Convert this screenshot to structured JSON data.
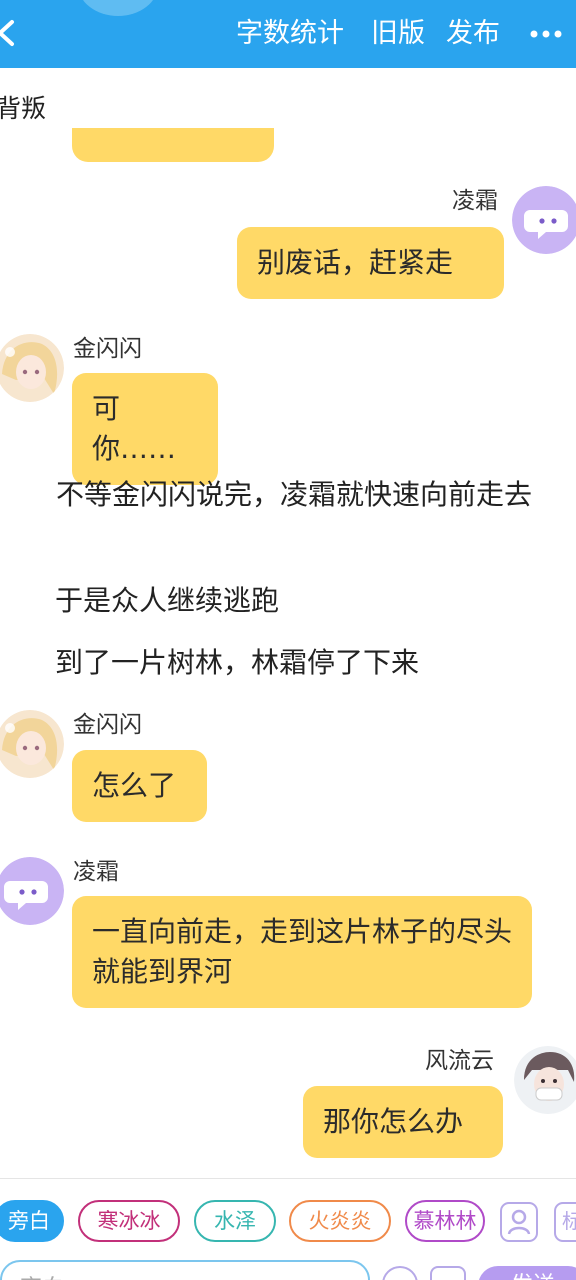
{
  "header": {
    "word_count_label": "字数统计",
    "old_version_label": "旧版",
    "publish_label": "发布"
  },
  "chat": {
    "truncated_text": "背叛",
    "messages": [
      {
        "speaker": "凌霜",
        "text": "别废话，赶紧走"
      },
      {
        "speaker": "金闪闪",
        "text": "可你……"
      },
      {
        "speaker": "金闪闪",
        "text": "怎么了"
      },
      {
        "speaker": "凌霜",
        "text": "一直向前走，走到这片林子的尽头就能到界河"
      },
      {
        "speaker": "风流云",
        "text": "那你怎么办"
      }
    ],
    "narration": [
      "不等金闪闪说完，凌霜就快速向前走去",
      "于是众人继续逃跑",
      "到了一片树林，林霜停了下来"
    ]
  },
  "composer": {
    "tags": [
      "旁白",
      "寒冰冰",
      "水泽",
      "火炎炎",
      "慕林林"
    ],
    "tag_colors": [
      "#2aa4ee",
      "#c2307a",
      "#36b6b0",
      "#f08a4a",
      "#b04ac8"
    ],
    "side_icon_2_text": "标",
    "input_placeholder": "齐白",
    "send_label": "发送"
  }
}
